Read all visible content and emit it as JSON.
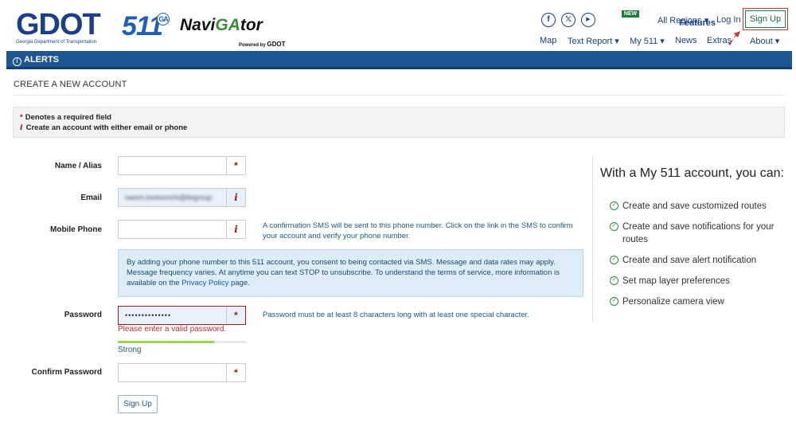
{
  "header": {
    "logo_gdot": "GDOT",
    "logo_gdot_sub": "Georgia Department of Transportation",
    "logo_511": "511",
    "logo_511_badge": "GA",
    "logo_nav_pre": "Navi",
    "logo_nav_ga": "GA",
    "logo_nav_post": "tor",
    "logo_nav_powered": "Powered by",
    "logo_nav_powered_brand": "GDOT",
    "social": [
      {
        "icon": "facebook-icon",
        "glyph": "f"
      },
      {
        "icon": "x-icon",
        "glyph": "𝕏"
      },
      {
        "icon": "youtube-icon",
        "glyph": "▶"
      }
    ],
    "features_badge": "NEW",
    "features": "Features",
    "all_regions": "All Regions ▾",
    "log_in": "Log In",
    "sign_up": "Sign Up",
    "nav": [
      {
        "label": "Map"
      },
      {
        "label": "Text Report ▾"
      },
      {
        "label": "My 511 ▾"
      },
      {
        "label": "News"
      },
      {
        "label": "Extras"
      },
      {
        "label": "About ▾"
      }
    ]
  },
  "alerts": {
    "label": "ALERTS"
  },
  "page": {
    "title": "CREATE A NEW ACCOUNT",
    "required_note": "Denotes a required field",
    "info_note": "Create an account with either email or phone",
    "required_mark": "*",
    "info_mark": "i"
  },
  "form": {
    "name_label": "Name / Alias",
    "name_value": "",
    "email_label": "Email",
    "email_value": "nasim.tootoonchi@ibigroup",
    "phone_label": "Mobile Phone",
    "phone_value": "",
    "phone_help": "A confirmation SMS will be sent to this phone number. Click on the link in the SMS to confirm your account and verify your phone number.",
    "consent_text": "By adding your phone number to this 511 account, you consent to being contacted via SMS. Message and data rates may apply. Message frequency varies. At anytime you can text STOP to unsubscribe. To understand the terms of service, more information is available on the",
    "consent_link": "Privacy Policy",
    "consent_end": "page.",
    "password_label": "Password",
    "password_value": "••••••••••••••",
    "password_help": "Password must be at least 8 characters long with at least one special character.",
    "password_error": "Please enter a valid password.",
    "strength_label": "Strong",
    "strength_fraction": 0.75,
    "confirm_label": "Confirm Password",
    "confirm_value": "",
    "submit": "Sign Up"
  },
  "side": {
    "title": "With a My 511 account, you can:",
    "benefits": [
      "Create and save customized routes",
      "Create and save notifications for your routes",
      "Create and save alert notification",
      "Set map layer preferences",
      "Personalize camera view"
    ]
  },
  "colors": {
    "brand_blue": "#1b3f8b",
    "alerts_bar": "#1d5693",
    "required_red": "#a01818",
    "check_green": "#2d8a3e",
    "strength_green": "#9ed14b"
  }
}
